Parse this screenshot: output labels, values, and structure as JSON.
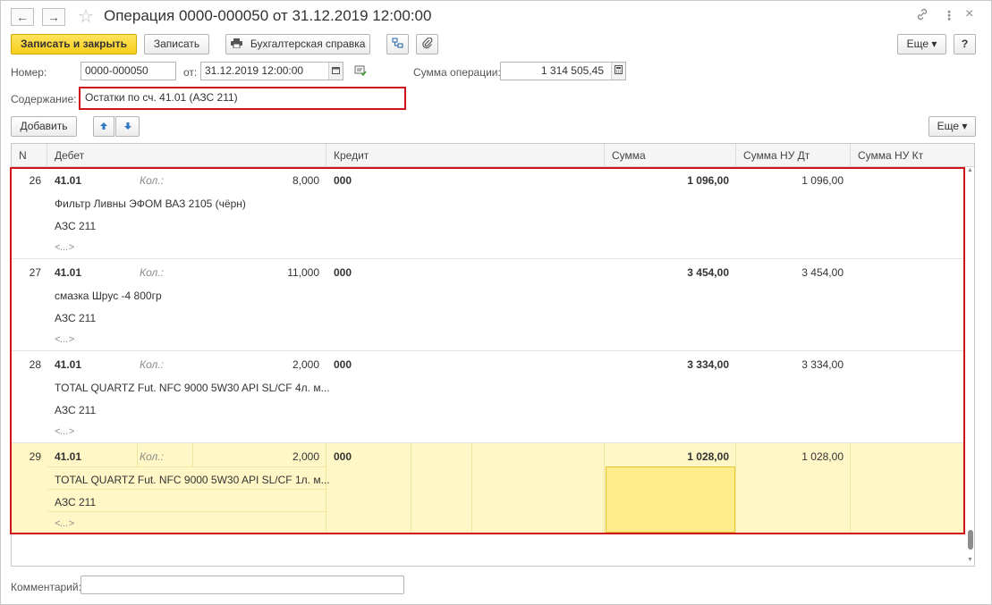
{
  "window": {
    "title": "Операция 0000-000050 от 31.12.2019 12:00:00",
    "back_icon": "←",
    "forward_icon": "→",
    "favorite_icon": "☆",
    "link_icon": "🔗",
    "more_icon": "⋮",
    "close_icon": "×"
  },
  "toolbar": {
    "save_close_label": "Записать и закрыть",
    "save_label": "Записать",
    "report_label": "Бухгалтерская справка",
    "more_label": "Еще ▾",
    "help_label": "?"
  },
  "form": {
    "number_label": "Номер:",
    "number_value": "0000-000050",
    "date_label": "от:",
    "date_value": "31.12.2019 12:00:00",
    "amount_label": "Сумма операции:",
    "amount_value": "1 314 505,45",
    "content_label": "Содержание:",
    "content_value": "Остатки по сч. 41.01 (АЗС 211)",
    "comment_label": "Комментарий:",
    "comment_value": ""
  },
  "table_toolbar": {
    "add_label": "Добавить",
    "more_label": "Еще ▾"
  },
  "table": {
    "columns": [
      "N",
      "Дебет",
      "Кредит",
      "Сумма",
      "Сумма НУ Дт",
      "Сумма НУ Кт"
    ],
    "qty_label": "Кол.:",
    "empty_value": "<...>",
    "rows": [
      {
        "n": "26",
        "debit": "41.01",
        "qty": "8,000",
        "item": "Фильтр Ливны ЭФОМ ВАЗ 2105 (чёрн)",
        "subconto": "АЗС 211",
        "credit": "000",
        "amount": "1 096,00",
        "nu_dt": "1 096,00",
        "nu_kt": ""
      },
      {
        "n": "27",
        "debit": "41.01",
        "qty": "11,000",
        "item": "смазка Шрус -4 800гр",
        "subconto": "АЗС 211",
        "credit": "000",
        "amount": "3 454,00",
        "nu_dt": "3 454,00",
        "nu_kt": ""
      },
      {
        "n": "28",
        "debit": "41.01",
        "qty": "2,000",
        "item": "TOTAL QUARTZ Fut. NFC 9000 5W30 API SL/CF 4л. м...",
        "subconto": "АЗС 211",
        "credit": "000",
        "amount": "3 334,00",
        "nu_dt": "3 334,00",
        "nu_kt": ""
      },
      {
        "n": "29",
        "debit": "41.01",
        "qty": "2,000",
        "item": "TOTAL QUARTZ Fut. NFC 9000 5W30 API SL/CF 1л. м...",
        "subconto": "АЗС 211",
        "credit": "000",
        "amount": "1 028,00",
        "nu_dt": "1 028,00",
        "nu_kt": ""
      }
    ]
  }
}
